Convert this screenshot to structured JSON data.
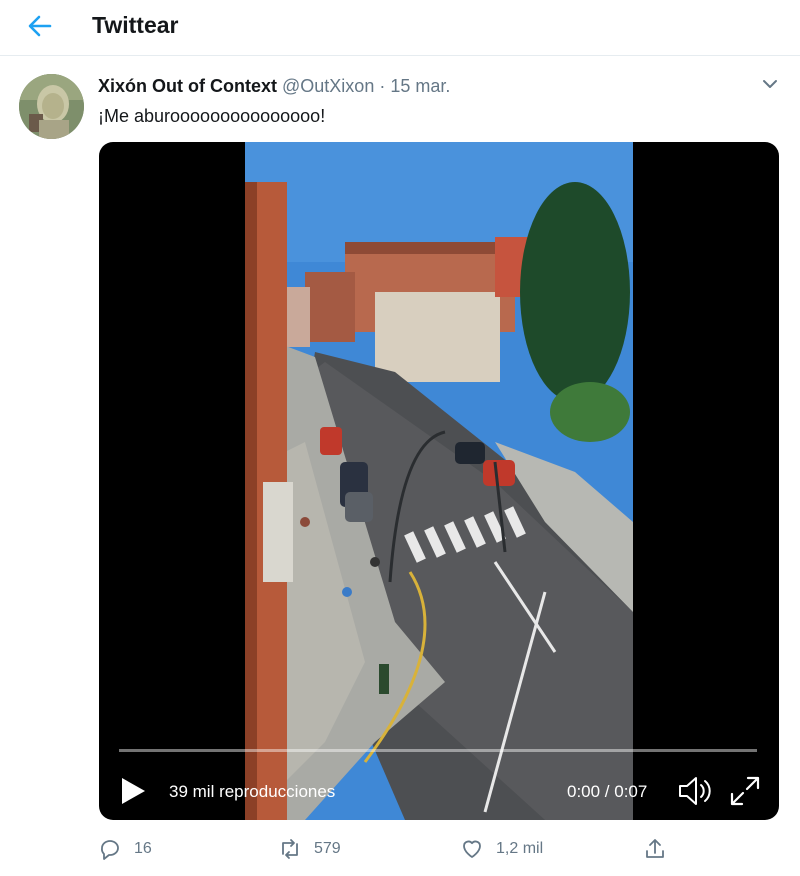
{
  "header": {
    "title": "Twittear"
  },
  "tweet": {
    "display_name": "Xixón Out of Context",
    "handle": "@OutXixon",
    "separator": "·",
    "date": "15 mar.",
    "text": "¡Me aburooooooooooooooo!"
  },
  "video": {
    "views": "39 mil reproducciones",
    "time": "0:00 / 0:07",
    "progress": 0
  },
  "actions": {
    "replies": "16",
    "retweets": "579",
    "likes": "1,2 mil"
  },
  "colors": {
    "accent": "#1da1f2",
    "muted": "#657786",
    "text": "#14171a"
  }
}
